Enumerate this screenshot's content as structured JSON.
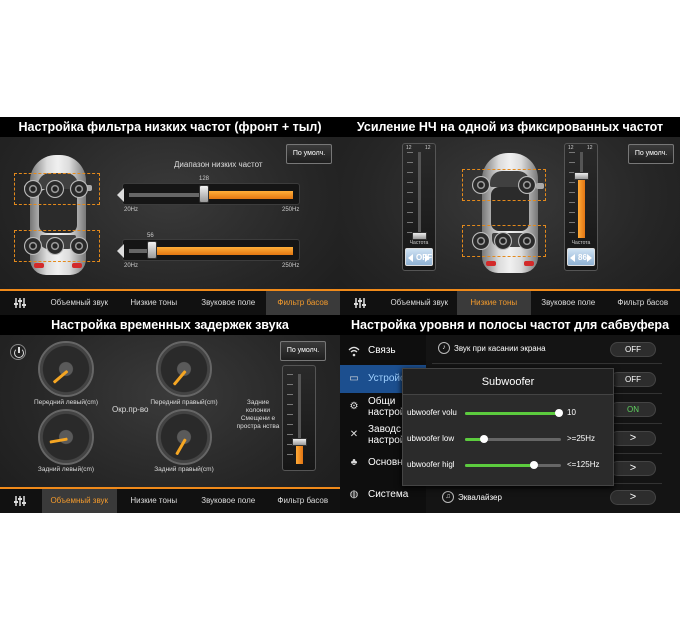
{
  "q1": {
    "title": "Настройка фильтра низких частот (фронт + тыл)",
    "default_label": "По умолч.",
    "range_label": "Диапазон низких частот",
    "front": {
      "value": "128",
      "min": "20Hz",
      "max": "250Hz",
      "fraction": 0.47
    },
    "rear": {
      "value": "56",
      "min": "20Hz",
      "max": "250Hz",
      "fraction": 0.17
    }
  },
  "q2": {
    "title": "Усиление НЧ на одной из фиксированных частот",
    "default_label": "По умолч.",
    "left_panel": {
      "top": "12",
      "bottom": "-12",
      "label": "Частота",
      "value": "OFF",
      "fraction": 0.0
    },
    "right_panel": {
      "top": "12",
      "bottom": "-12",
      "label": "Частота",
      "value": "86",
      "fraction": 0.62
    }
  },
  "q3": {
    "title": "Настройка временных задержек звука",
    "default_label": "По умолч.",
    "front_left": "Передний левый(cm)",
    "front_right": "Передний правый(cm)",
    "rear_left": "Задний левый(cm)",
    "rear_right": "Задний правый(cm)",
    "center": "Окр.пр-во",
    "side_text": "Задние колонки Смещени е простра нства"
  },
  "tabs_top": {
    "eq_icon": "equalizer-icon",
    "items": [
      "Объемный звук",
      "Низкие тоны",
      "Звуковое поле",
      "Фильтр басов"
    ],
    "active": 3
  },
  "tabs_top_right": {
    "items": [
      "Объемный звук",
      "Низкие тоны",
      "Звуковое поле",
      "Фильтр басов"
    ],
    "active": 1
  },
  "tabs_bottom": {
    "items": [
      "Объемный звук",
      "Низкие тоны",
      "Звуковое поле",
      "Фильтр басов"
    ],
    "active": 0
  },
  "q4": {
    "title": "Настройка уровня и полосы частот для сабвуфера",
    "sidebar": [
      "Связь",
      "Устройс",
      "Общи настрой",
      "Заводс настрой",
      "Основн",
      "Система"
    ],
    "rows": [
      {
        "label": "Звук при касании экрана",
        "control": "OFF"
      },
      {
        "label": "",
        "control": "OFF"
      },
      {
        "label": "",
        "control": "ON"
      },
      {
        "label": "",
        "control": ">"
      },
      {
        "label": "",
        "control": ">"
      },
      {
        "label": "Эквалайзер",
        "control": ">"
      }
    ],
    "dialog": {
      "title": "Subwoofer",
      "rows": [
        {
          "label": "ubwoofer volu",
          "value": "10",
          "fraction": 0.98
        },
        {
          "label": "ubwoofer low",
          "value": ">=25Hz",
          "fraction": 0.2
        },
        {
          "label": "ubwoofer higl",
          "value": "<=125Hz",
          "fraction": 0.72
        }
      ]
    }
  },
  "colors": {
    "accent": "#f08a1a",
    "active_side": "#1c4f8f",
    "on": "#5fd25f",
    "slider_green": "#5ccc3e"
  }
}
